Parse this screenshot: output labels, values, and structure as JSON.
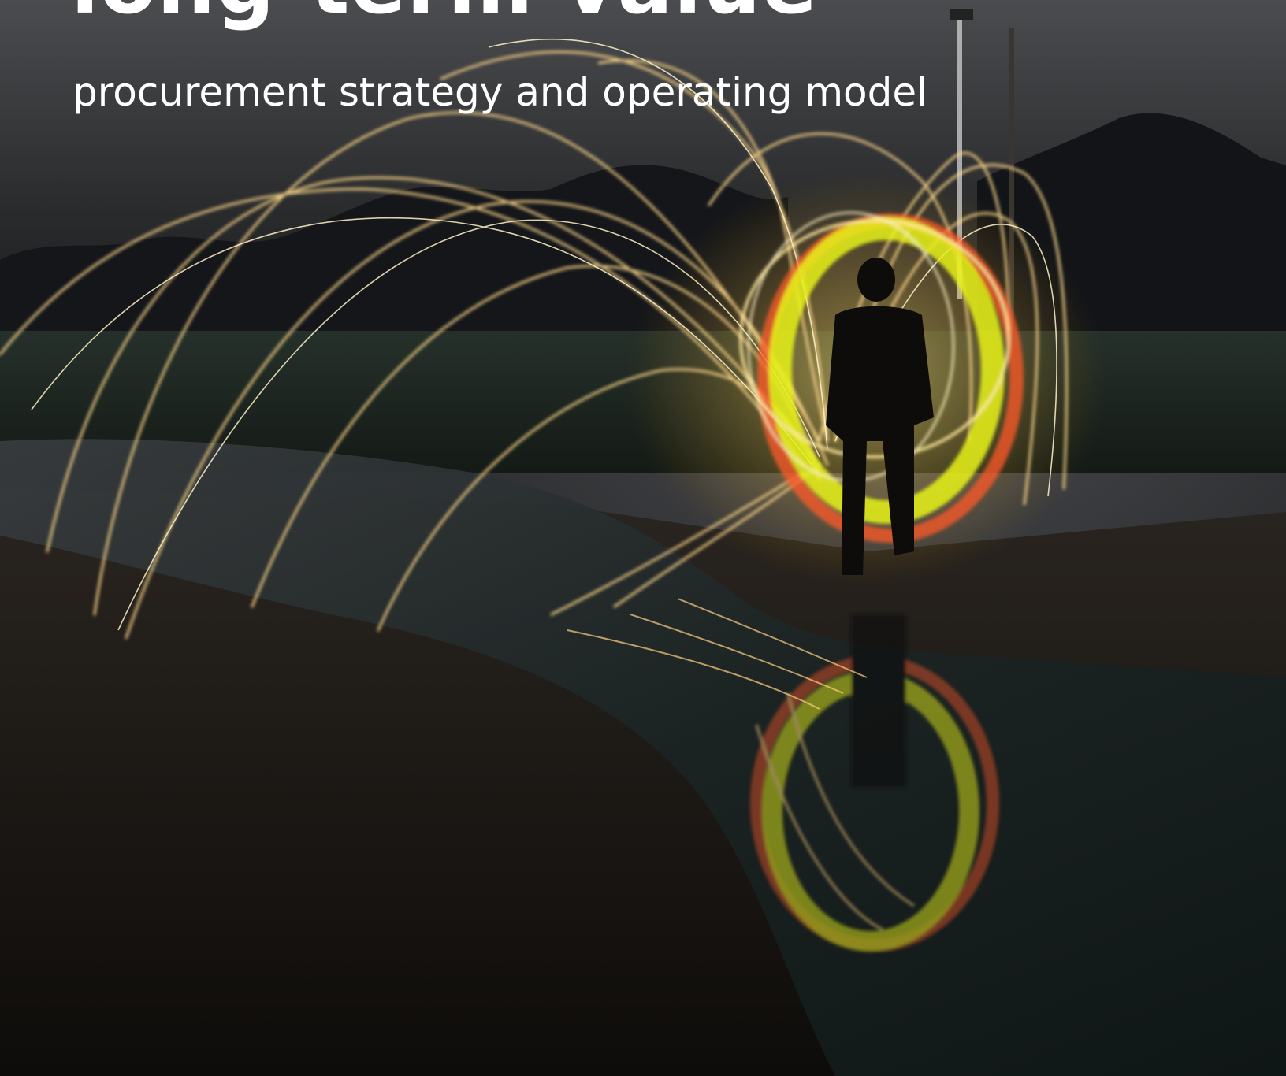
{
  "cover": {
    "headline": "long-term value",
    "subtitle": "procurement strategy and operating model"
  },
  "photo": {
    "description_icon": "steel-wool-light-painting-photo"
  },
  "colors": {
    "text": "#ffffff",
    "sky": "#3e3f42",
    "ground": "#1a1612",
    "spark_gold": "#ffd36a",
    "ring_yellow": "#e8f21a",
    "ring_red": "#ff5a2a",
    "water": "#1d2a2a"
  }
}
